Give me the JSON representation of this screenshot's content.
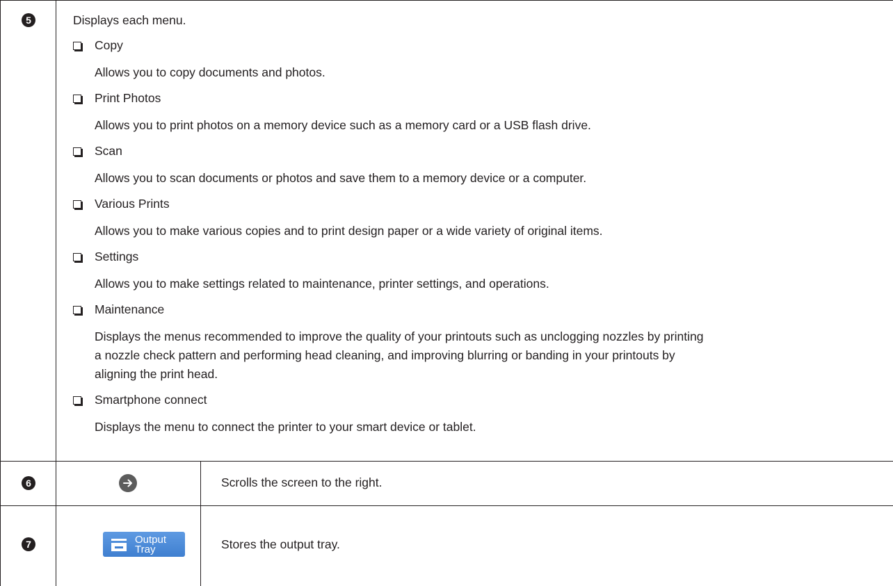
{
  "rows": [
    {
      "number": "5",
      "intro": "Displays each menu.",
      "items": [
        {
          "name": "Copy",
          "description": "Allows you to copy documents and photos."
        },
        {
          "name": "Print Photos",
          "description": "Allows you to print photos on a memory device such as a memory card or a USB flash drive."
        },
        {
          "name": "Scan",
          "description": "Allows you to scan documents or photos and save them to a memory device or a computer."
        },
        {
          "name": "Various Prints",
          "description": "Allows you to make various copies and to print design paper or a wide variety of original items."
        },
        {
          "name": "Settings",
          "description": "Allows you to make settings related to maintenance, printer settings, and operations."
        },
        {
          "name": "Maintenance",
          "description_lines": [
            "Displays the menus recommended to improve the quality of your printouts such as unclogging nozzles by printing",
            "a nozzle check pattern and performing head cleaning, and improving blurring or banding in your printouts by",
            "aligning the print head."
          ]
        },
        {
          "name": "Smartphone connect",
          "description": "Displays the menu to connect the printer to your smart device or tablet."
        }
      ]
    },
    {
      "number": "6",
      "icon": "right-arrow-icon",
      "description": "Scrolls the screen to the right."
    },
    {
      "number": "7",
      "button_label_1": "Output",
      "button_label_2": "Tray",
      "description": "Stores the output tray."
    }
  ],
  "colors": {
    "text": "#231f20",
    "button_blue": "#4a8ad8",
    "arrow_gray": "#5c5c5c"
  }
}
